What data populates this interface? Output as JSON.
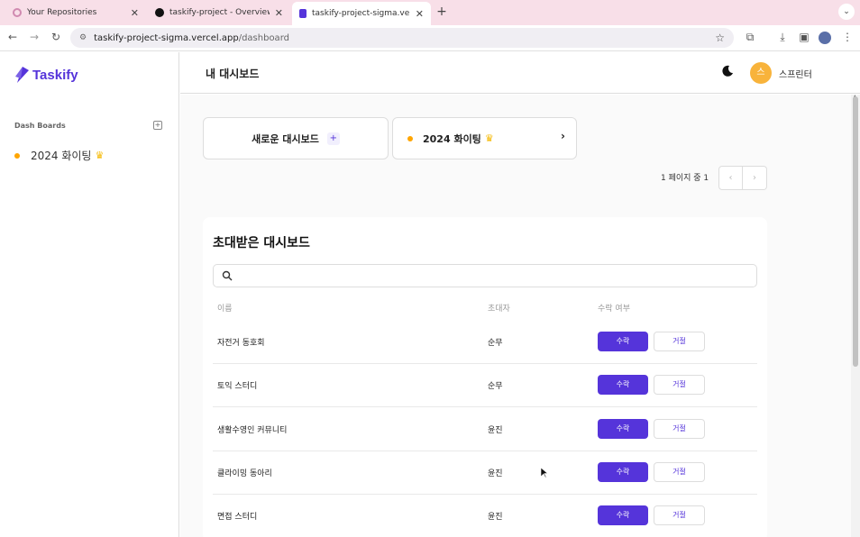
{
  "browser": {
    "tabs": [
      {
        "title": "Your Repositories",
        "active": false
      },
      {
        "title": "taskify-project - Overview - V",
        "active": false
      },
      {
        "title": "taskify-project-sigma.vercel.a",
        "active": true
      }
    ],
    "url_host": "taskify-project-sigma.vercel.app",
    "url_path": "/dashboard"
  },
  "sidebar": {
    "brand": "Taskify",
    "section_label": "Dash Boards",
    "add_symbol": "+",
    "items": [
      {
        "label": "2024 화이팅",
        "color": "#ffa500",
        "owner_crown": true
      }
    ]
  },
  "header": {
    "title": "내 대시보드",
    "user_initial": "스",
    "user_name": "스프린터"
  },
  "dashboards": {
    "new_label": "새로운 대시보드",
    "new_symbol": "+",
    "boards": [
      {
        "label": "2024 화이팅",
        "color": "#ffa500",
        "owner_crown": true
      }
    ],
    "pagination_text": "1 페이지 중 1",
    "prev_symbol": "‹",
    "next_symbol": "›"
  },
  "invited": {
    "title": "초대받은 대시보드",
    "search_placeholder": "",
    "columns": [
      "이름",
      "초대자",
      "수락 여부"
    ],
    "accept_label": "수락",
    "reject_label": "거절",
    "rows": [
      {
        "name": "자전거 동호회",
        "inviter": "순무"
      },
      {
        "name": "토익 스터디",
        "inviter": "순무"
      },
      {
        "name": "생활수영인 커뮤니티",
        "inviter": "윤진"
      },
      {
        "name": "클라이밍 동아리",
        "inviter": "윤진"
      },
      {
        "name": "면접 스터디",
        "inviter": "윤진"
      }
    ]
  },
  "colors": {
    "accent": "#5534da",
    "dot": "#ffa500",
    "crown": "#f5b800"
  }
}
